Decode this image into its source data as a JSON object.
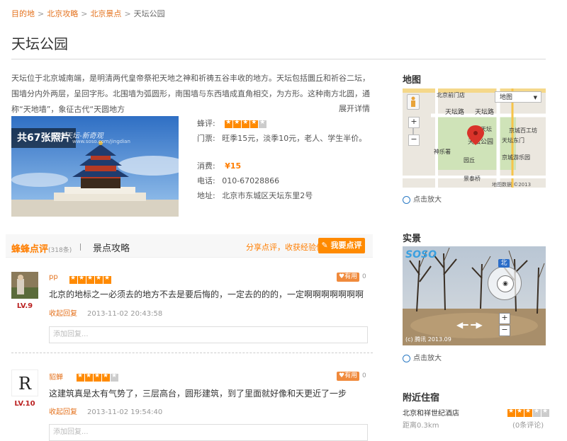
{
  "breadcrumb": {
    "items": [
      "目的地",
      "北京攻略",
      "北京景点"
    ],
    "current": "天坛公园"
  },
  "page_title": "天坛公园",
  "description": "天坛位于北京城南端，是明清两代皇帝祭祀天地之神和祈祷五谷丰收的地方。天坛包括圜丘和祈谷二坛，围墙分内外两层，呈回字形。北围墙为弧圆形，南围墙与东西墙成直角相交，为方形。这种南方北圆，通称“天地墙”，象征古代“天圆地方",
  "expand_label": "展开详情",
  "photo": {
    "count_label": "共67张照片",
    "watermark": "北京天坛-新奇观",
    "watermark_url": "www.soso.com/jingdian"
  },
  "info": {
    "rating_label": "蜂评:",
    "rating": 4,
    "ticket_label": "门票:",
    "ticket_value": "旺季15元，淡季10元，老人、学生半价。",
    "cost_label": "消费:",
    "cost_value": "¥15",
    "phone_label": "电话:",
    "phone_value": "010-67028866",
    "address_label": "地址:",
    "address_value": "北京市东城区天坛东里2号"
  },
  "tabs": {
    "reviews_label": "蜂蜂点评",
    "reviews_count": "(318条)",
    "guide_label": "景点攻略",
    "share_label": "分享点评，收获经验值",
    "write_review_label": "我要点评"
  },
  "reviews": [
    {
      "username": "pp",
      "level": "LV.9",
      "stars": 5,
      "useful_label": "有用",
      "useful_count": "0",
      "text": "北京的地标之一必须去的地方不去是要后悔的，一定去的的的，一定啊啊啊啊啊啊啊",
      "reply_label": "收起回复",
      "time": "2013-11-02 20:43:58",
      "reply_placeholder": "添加回复..."
    },
    {
      "username": "貂蝉",
      "level": "LV.10",
      "stars": 4,
      "useful_label": "有用",
      "useful_count": "0",
      "text": "这建筑真是太有气势了，三层高台，圆形建筑，到了里面就好像和天更近了一步",
      "reply_label": "收起回复",
      "time": "2013-11-02 19:54:40",
      "reply_placeholder": "添加回复..."
    }
  ],
  "sidebar": {
    "map_heading": "地图",
    "map_zoom_label": "点击放大",
    "map_type": "地图",
    "map_labels": {
      "road1": "天坛路",
      "road2": "天坛路",
      "poi1": "北京前门店",
      "poi2": "天坛公园",
      "poi3": "京城百工坊",
      "poi4": "神乐署",
      "poi5": "园丘",
      "poi6": "京城游乐园",
      "poi7": "景泰桥",
      "poi8": "天坛东门",
      "poi9": "宾馆",
      "poi10": "天坛",
      "copyright": "地图数据 ©2013"
    },
    "street_heading": "实景",
    "street_zoom_label": "点击放大",
    "street_compass": "北",
    "street_copyright": "(c) 腾讯 2013.09",
    "hotel_heading": "附近住宿",
    "hotel": {
      "name": "北京和祥世纪酒店",
      "distance": "距离0.3km",
      "rating": 3,
      "comments": "(0条评论)"
    }
  }
}
